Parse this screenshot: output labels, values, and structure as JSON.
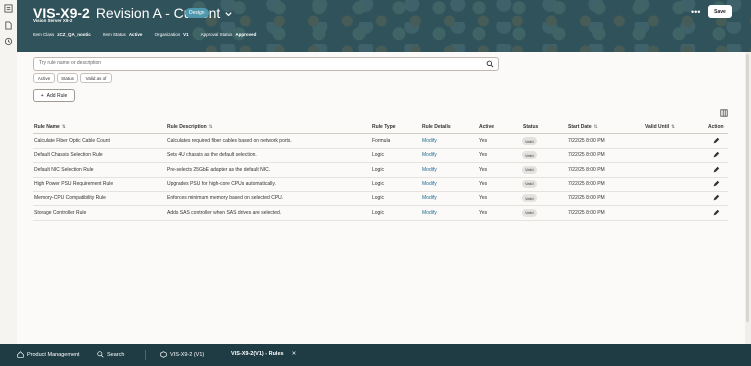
{
  "header": {
    "title": "VIS-X9-2",
    "revision": "Revision A - Current",
    "badge": "Design",
    "subtitle": "Vision Server X9-2",
    "meta": [
      {
        "key": "Item Class",
        "value": "zCZ_QA_nootic"
      },
      {
        "key": "Item Status",
        "value": "Active"
      },
      {
        "key": "Organization",
        "value": "V1"
      },
      {
        "key": "Approval Status",
        "value": "Approved"
      }
    ],
    "more": "•••",
    "save_label": "Save"
  },
  "search": {
    "placeholder": "Try rule name or description"
  },
  "filters": [
    "Active",
    "Status",
    "Valid as of"
  ],
  "add_rule_label": "Add Rule",
  "table": {
    "columns": [
      "Rule Name",
      "Rule Description",
      "Rule Type",
      "Rule Details",
      "Active",
      "Status",
      "Start Date",
      "Valid Until",
      "Action"
    ],
    "rows": [
      {
        "name": "Calculate Fiber Optic Cable Count",
        "description": "Calculates required fiber cables based on network ports.",
        "type": "Formula",
        "details": "Modify",
        "active": "Yes",
        "status": "Valid",
        "start": "7/22/25 8:00 PM",
        "until": ""
      },
      {
        "name": "Default Chassis Selection Rule",
        "description": "Sets 4U chassis as the default selection.",
        "type": "Logic",
        "details": "Modify",
        "active": "Yes",
        "status": "Valid",
        "start": "7/22/25 8:00 PM",
        "until": ""
      },
      {
        "name": "Default NIC Selection Rule",
        "description": "Pre-selects 25GbE adapter as the default NIC.",
        "type": "Logic",
        "details": "Modify",
        "active": "Yes",
        "status": "Valid",
        "start": "7/22/25 8:00 PM",
        "until": ""
      },
      {
        "name": "High Power PSU Requirement Rule",
        "description": "Upgrades PSU for high-core CPUs automatically.",
        "type": "Logic",
        "details": "Modify",
        "active": "Yes",
        "status": "Valid",
        "start": "7/22/25 8:00 PM",
        "until": ""
      },
      {
        "name": "Memory-CPU Compatibility Rule",
        "description": "Enforces minimum memory based on selected CPU.",
        "type": "Logic",
        "details": "Modify",
        "active": "Yes",
        "status": "Valid",
        "start": "7/22/25 8:00 PM",
        "until": ""
      },
      {
        "name": "Storage Controller Rule",
        "description": "Adds SAS controller when SAS drives are selected.",
        "type": "Logic",
        "details": "Modify",
        "active": "Yes",
        "status": "Valid",
        "start": "7/22/25 8:00 PM",
        "until": ""
      }
    ]
  },
  "taskbar": {
    "items": [
      "Product Management",
      "Search",
      "VIS-X9-2 (V1)",
      "VIS-X9-2(V1) - Rules"
    ],
    "close": "✕"
  },
  "colors": {
    "header": "#30525a",
    "taskbar": "#1f3c44",
    "badge": "#4f97ad",
    "link": "#1d6b8f"
  }
}
